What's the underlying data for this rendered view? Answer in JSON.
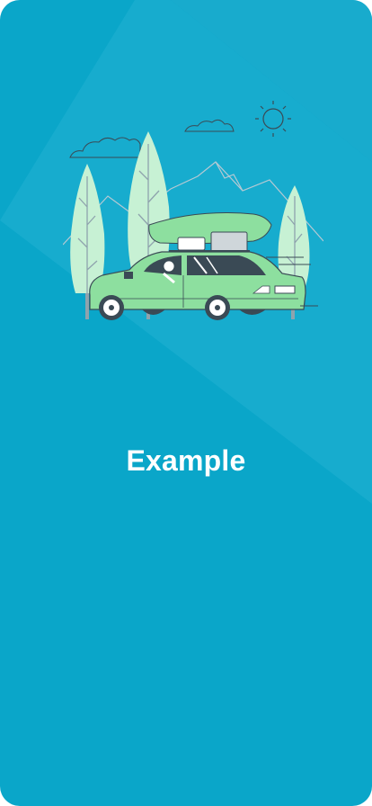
{
  "screen": {
    "title": "Example",
    "illustration": "car-road-trip-illustration",
    "colors": {
      "background": "#0aa6c9",
      "background_light": "#22b0d1",
      "title": "#ffffff",
      "car": "#8ddf9f",
      "trees": "#c7f1d4"
    }
  }
}
